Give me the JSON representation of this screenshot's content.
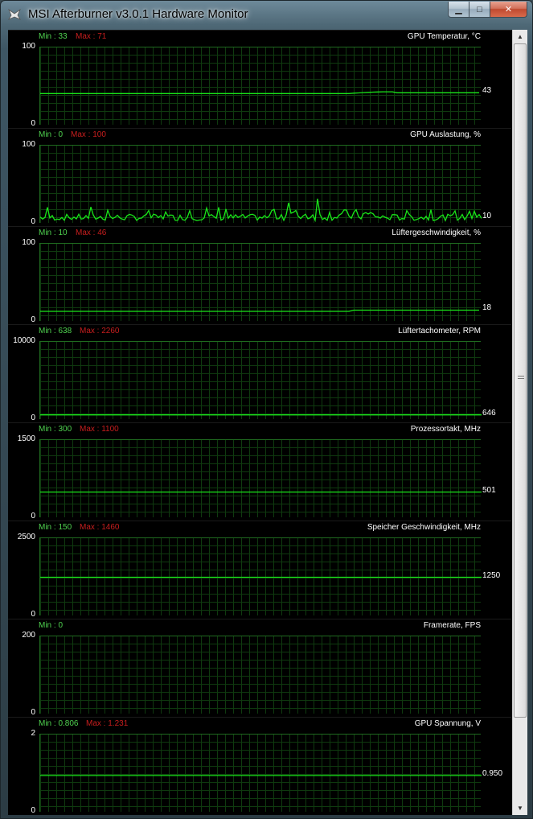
{
  "window": {
    "title": "MSI Afterburner v3.0.1 Hardware Monitor"
  },
  "caption": {
    "minimize": "▁",
    "maximize": "□",
    "close": "✕"
  },
  "colors": {
    "min": "#4fd24f",
    "max": "#c81e1e",
    "line": "#19e619",
    "grid": "#0f3a0f"
  },
  "graphs": [
    {
      "min_label": "Min : 33",
      "max_label": "Max : 71",
      "name": "GPU Temperatur, °C",
      "y_top": "100",
      "y_bottom": "0",
      "current": "43",
      "level": 0.42,
      "style": "flat-step"
    },
    {
      "min_label": "Min : 0",
      "max_label": "Max : 100",
      "name": "GPU Auslastung, %",
      "y_top": "100",
      "y_bottom": "0",
      "current": "10",
      "level": 0.07,
      "style": "noisy"
    },
    {
      "min_label": "Min : 10",
      "max_label": "Max : 46",
      "name": "Lüftergeschwindigkeit, %",
      "y_top": "100",
      "y_bottom": "0",
      "current": "18",
      "level": 0.15,
      "style": "flat-step"
    },
    {
      "min_label": "Min : 638",
      "max_label": "Max : 2260",
      "name": "Lüftertachometer, RPM",
      "y_top": "10000",
      "y_bottom": "0",
      "current": "646",
      "level": 0.065,
      "style": "flat"
    },
    {
      "min_label": "Min : 300",
      "max_label": "Max : 1100",
      "name": "Prozessortakt, MHz",
      "y_top": "1500",
      "y_bottom": "0",
      "current": "501",
      "level": 0.334,
      "style": "flat"
    },
    {
      "min_label": "Min : 150",
      "max_label": "Max : 1460",
      "name": "Speicher Geschwindigkeit, MHz",
      "y_top": "2500",
      "y_bottom": "0",
      "current": "1250",
      "level": 0.5,
      "style": "flat"
    },
    {
      "min_label": "Min : 0",
      "max_label": "",
      "name": "Framerate, FPS",
      "y_top": "200",
      "y_bottom": "0",
      "current": "",
      "level": null,
      "style": "none"
    },
    {
      "min_label": "Min : 0.806",
      "max_label": "Max : 1.231",
      "name": "GPU Spannung, V",
      "y_top": "2",
      "y_bottom": "0",
      "current": "0.950",
      "level": 0.475,
      "style": "flat"
    }
  ]
}
